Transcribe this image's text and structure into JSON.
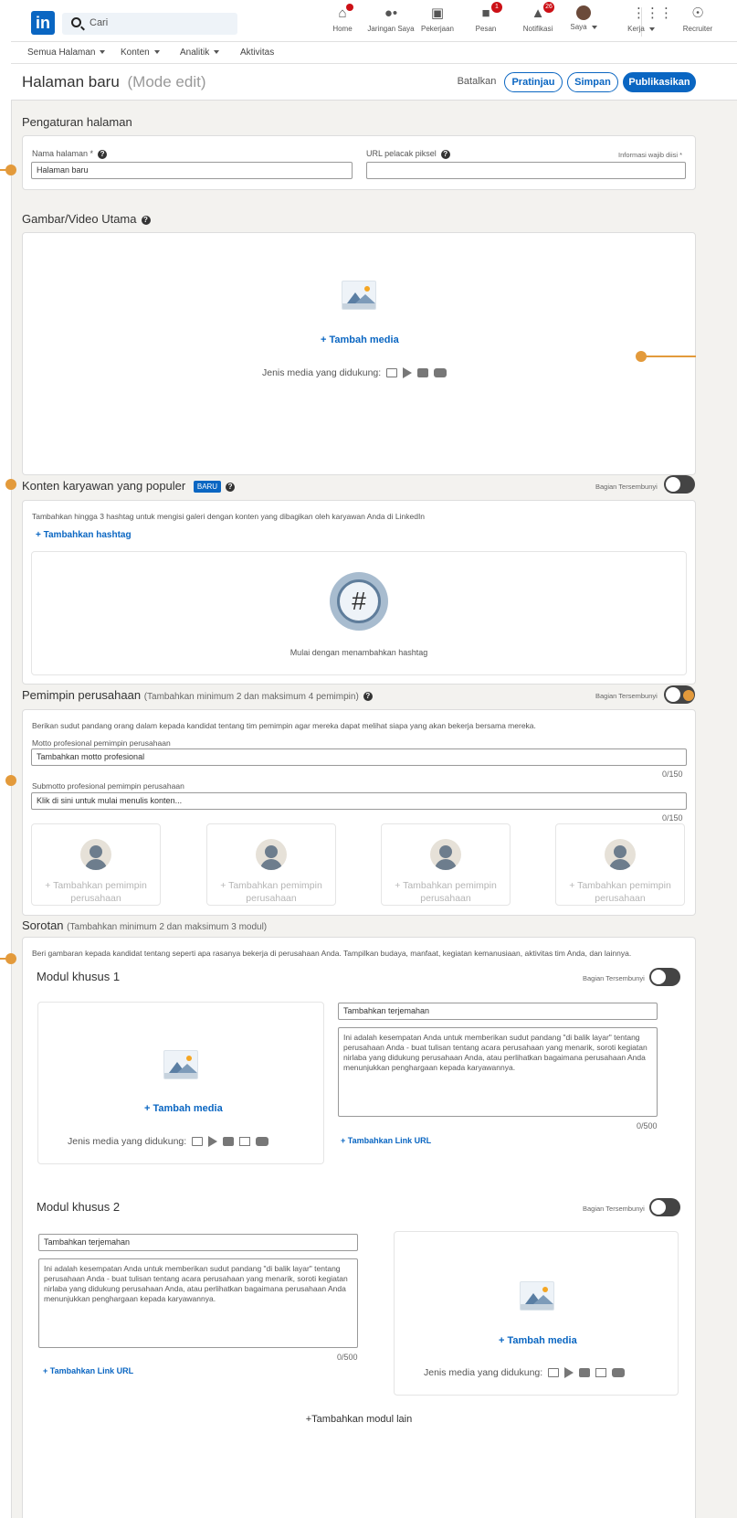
{
  "nav": {
    "search_placeholder": "Cari",
    "items": [
      {
        "label": "Home",
        "icon": "home-icon",
        "badge": ""
      },
      {
        "label": "Jaringan Saya",
        "icon": "network-icon",
        "badge": ""
      },
      {
        "label": "Pekerjaan",
        "icon": "briefcase-icon",
        "badge": ""
      },
      {
        "label": "Pesan",
        "icon": "message-icon",
        "badge": "1"
      },
      {
        "label": "Notifikasi",
        "icon": "bell-icon",
        "badge": "26"
      },
      {
        "label": "Saya",
        "icon": "avatar-icon",
        "badge": ""
      },
      {
        "label": "Kerja",
        "icon": "grid-icon",
        "badge": ""
      },
      {
        "label": "Recruiter",
        "icon": "recruiter-icon",
        "badge": ""
      }
    ]
  },
  "subnav": {
    "all_pages": "Semua Halaman",
    "content": "Konten",
    "analytics": "Analitik",
    "activity": "Aktivitas"
  },
  "header": {
    "title": "Halaman baru",
    "mode": "(Mode edit)",
    "cancel": "Batalkan",
    "preview": "Pratinjau",
    "save": "Simpan",
    "publish": "Publikasikan"
  },
  "page_settings": {
    "title": "Pengaturan halaman",
    "name_label": "Nama halaman *",
    "name_value": "Halaman baru",
    "pixel_label": "URL pelacak piksel",
    "required_note": "Informasi wajib diisi *"
  },
  "hero": {
    "title": "Gambar/Video Utama",
    "add_media": "+ Tambah media",
    "supported": "Jenis media yang didukung:"
  },
  "employee": {
    "title": "Konten karyawan yang populer",
    "badge": "BARU",
    "hidden_label": "Bagian Tersembunyi",
    "description": "Tambahkan hingga 3 hashtag untuk mengisi galeri dengan konten yang dibagikan oleh karyawan Anda di LinkedIn",
    "add_hashtag": "+ Tambahkan hashtag",
    "start_text": "Mulai dengan menambahkan hashtag"
  },
  "leaders": {
    "title": "Pemimpin perusahaan",
    "subtitle": "(Tambahkan minimum 2 dan maksimum 4 pemimpin)",
    "hidden_label": "Bagian Tersembunyi",
    "description": "Berikan sudut pandang orang dalam kepada kandidat tentang tim pemimpin agar mereka dapat melihat siapa yang akan bekerja bersama mereka.",
    "motto_label": "Motto profesional pemimpin perusahaan",
    "motto_placeholder": "Tambahkan motto profesional",
    "motto_counter": "0/150",
    "submotto_label": "Submotto profesional pemimpin perusahaan",
    "submotto_placeholder": "Klik di sini untuk mulai menulis konten...",
    "submotto_counter": "0/150",
    "add_leader": "+ Tambahkan pemimpin perusahaan"
  },
  "highlights": {
    "title": "Sorotan",
    "subtitle": "(Tambahkan minimum 2 dan maksimum 3 modul)",
    "description": "Beri gambaran kepada kandidat tentang seperti apa rasanya bekerja di perusahaan Anda. Tampilkan budaya, manfaat, kegiatan kemanusiaan, aktivitas tim Anda, dan lainnya.",
    "hidden_label": "Bagian Tersembunyi",
    "module1_title": "Modul khusus 1",
    "module2_title": "Modul khusus 2",
    "translation_placeholder": "Tambahkan terjemahan",
    "body_placeholder": "Ini adalah kesempatan Anda untuk memberikan sudut pandang \"di balik layar\" tentang perusahaan Anda - buat tulisan tentang acara perusahaan yang menarik, soroti kegiatan nirlaba yang didukung perusahaan Anda, atau perlihatkan bagaimana perusahaan Anda menunjukkan penghargaan kepada karyawannya.",
    "counter": "0/500",
    "add_link": "+ Tambahkan Link URL",
    "add_media": "+ Tambah media",
    "supported": "Jenis media yang didukung:",
    "add_module": "+Tambahkan modul lain"
  }
}
